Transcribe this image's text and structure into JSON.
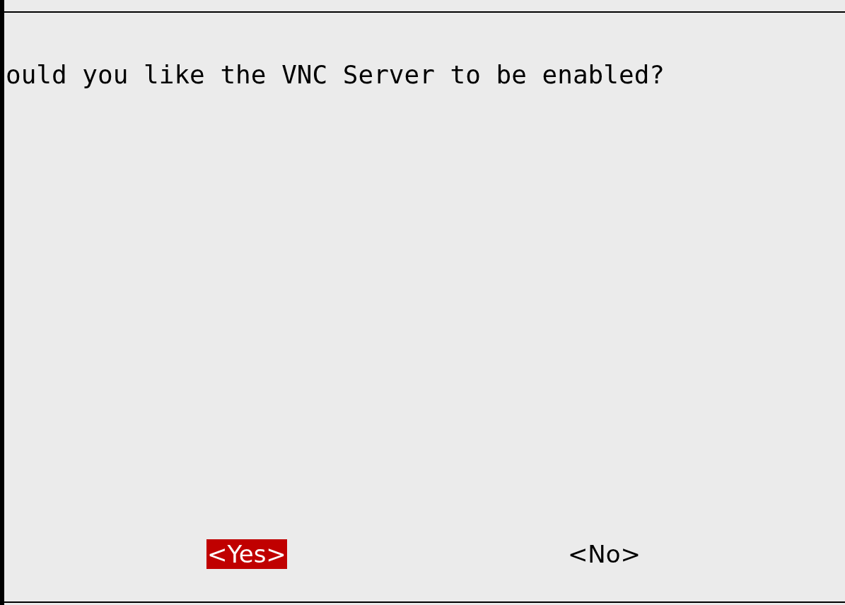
{
  "dialog": {
    "message": "ould you like the VNC Server to be enabled?",
    "buttons": [
      {
        "label": "<Yes>",
        "selected": true
      },
      {
        "label": "<No>",
        "selected": false
      }
    ]
  }
}
